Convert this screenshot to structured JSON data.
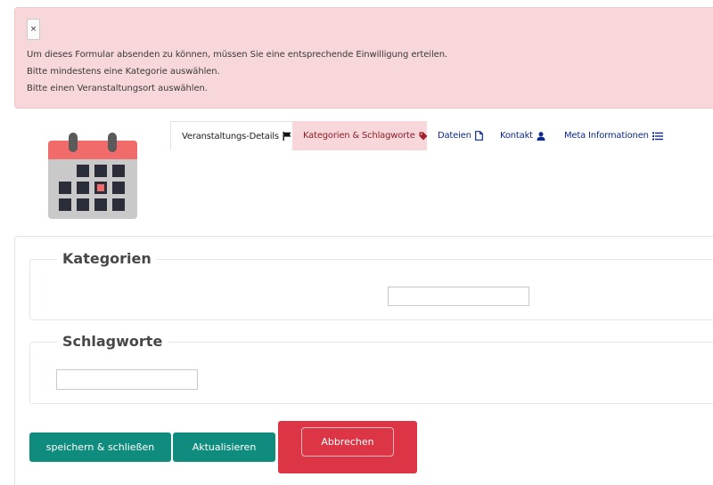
{
  "alert": {
    "close_label": "×",
    "messages": [
      "Um dieses Formular absenden zu können, müssen Sie eine entsprechende Einwilligung erteilen.",
      "Bitte mindestens eine Kategorie auswählen.",
      "Bitte einen Veranstaltungsort auswählen."
    ]
  },
  "tabs": [
    {
      "label": "Veranstaltungs-Details",
      "icon": "flag-icon"
    },
    {
      "label": "Kategorien & Schlagworte",
      "icon": "tag-icon"
    },
    {
      "label": "Dateien",
      "icon": "file-icon"
    },
    {
      "label": "Kontakt",
      "icon": "user-icon"
    },
    {
      "label": "Meta Informationen",
      "icon": "list-icon"
    }
  ],
  "sections": {
    "categories": {
      "legend": "Kategorien",
      "value": ""
    },
    "tags": {
      "legend": "Schlagworte",
      "value": ""
    }
  },
  "buttons": {
    "save_close": "speichern & schließen",
    "update": "Aktualisieren",
    "cancel": "Abbrechen"
  },
  "colors": {
    "alert_bg": "#f8d7da",
    "teal": "#0f8c7e",
    "danger": "#dc3545",
    "link": "#0d2a8c"
  }
}
